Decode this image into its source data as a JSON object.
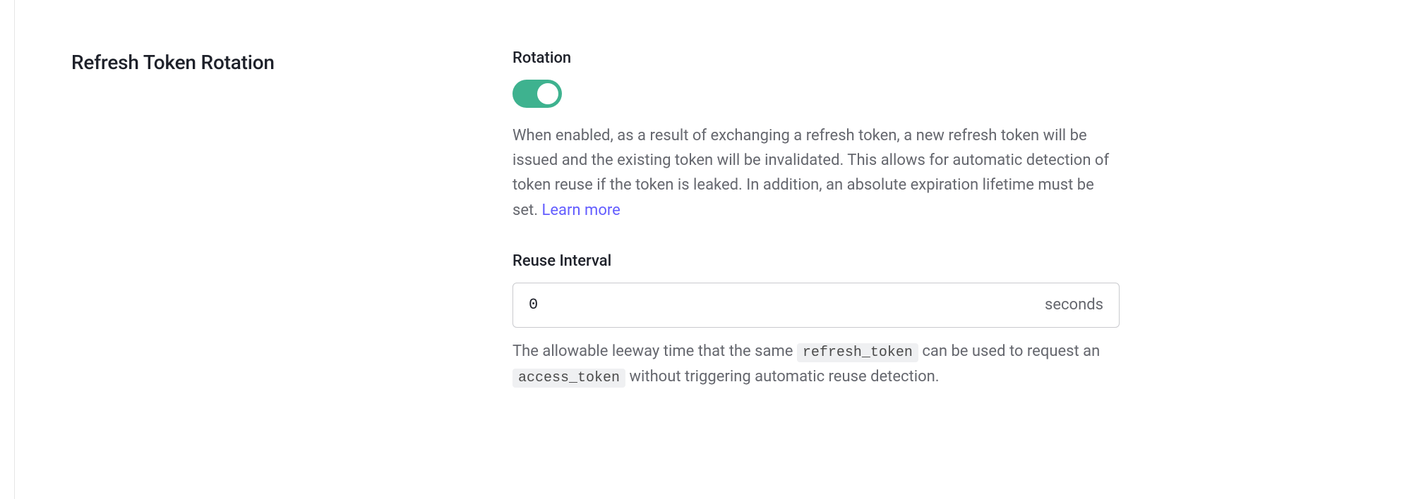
{
  "section": {
    "title": "Refresh Token Rotation"
  },
  "rotation": {
    "label": "Rotation",
    "enabled": true,
    "desc_before_link": "When enabled, as a result of exchanging a refresh token, a new refresh token will be issued and the existing token will be invalidated. This allows for automatic detection of token reuse if the token is leaked. In addition, an absolute expiration lifetime must be set. ",
    "learn_more": "Learn more"
  },
  "reuse_interval": {
    "label": "Reuse Interval",
    "value": "0",
    "unit": "seconds",
    "desc_1": "The allowable leeway time that the same ",
    "code_1": "refresh_token",
    "desc_2": " can be used to request an ",
    "code_2": "access_token",
    "desc_3": " without triggering automatic reuse detection."
  }
}
